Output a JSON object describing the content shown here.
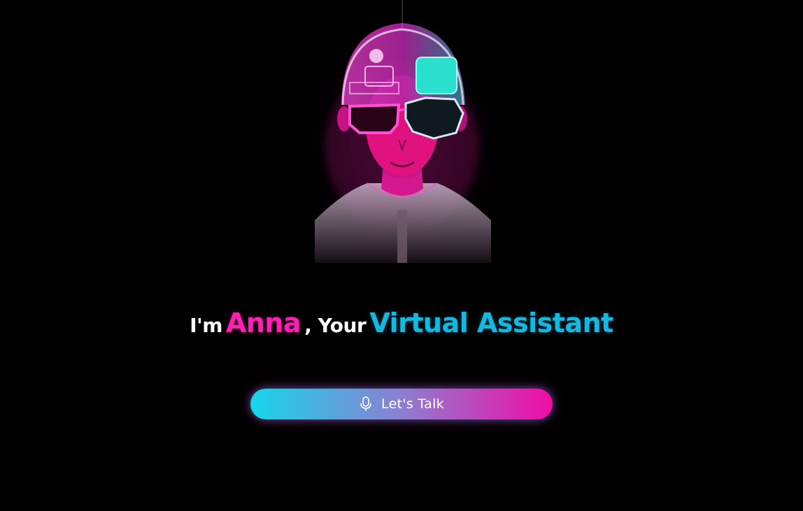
{
  "assistant": {
    "intro_prefix": "I'm",
    "name": "Anna",
    "intro_middle": ", Your",
    "role": "Virtual Assistant"
  },
  "action": {
    "talk_label": "Let's Talk",
    "icon": "microphone-icon"
  },
  "colors": {
    "background": "#000000",
    "name_pink": "#ff1fb3",
    "role_cyan": "#17b8e0",
    "button_gradient_start": "#17d6ea",
    "button_gradient_end": "#f20ca5"
  },
  "avatar": {
    "description_icon": "cyberpunk-avatar-image"
  }
}
